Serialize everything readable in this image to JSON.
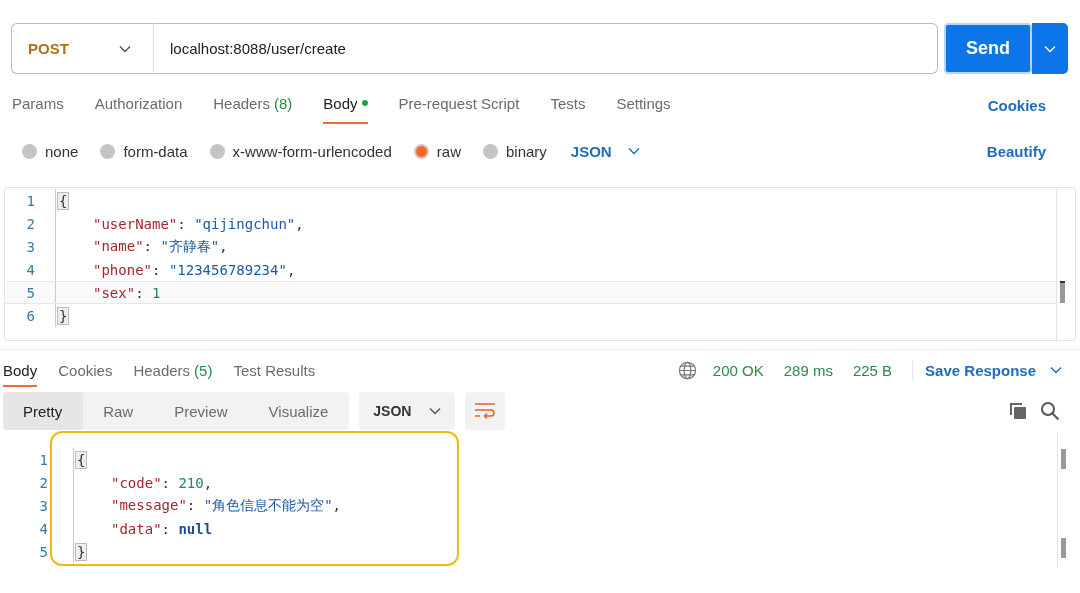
{
  "request": {
    "method": "POST",
    "url": "localhost:8088/user/create",
    "send_label": "Send"
  },
  "request_tabs": [
    {
      "label": "Params",
      "selected": false
    },
    {
      "label": "Authorization",
      "selected": false
    },
    {
      "label": "Headers",
      "count": "(8)",
      "selected": false
    },
    {
      "label": "Body",
      "selected": true,
      "dot": true
    },
    {
      "label": "Pre-request Script",
      "selected": false
    },
    {
      "label": "Tests",
      "selected": false
    },
    {
      "label": "Settings",
      "selected": false
    }
  ],
  "cookies_link": "Cookies",
  "body_types": [
    {
      "label": "none",
      "selected": false
    },
    {
      "label": "form-data",
      "selected": false
    },
    {
      "label": "x-www-form-urlencoded",
      "selected": false
    },
    {
      "label": "raw",
      "selected": true
    },
    {
      "label": "binary",
      "selected": false
    }
  ],
  "raw_format": "JSON",
  "beautify_link": "Beautify",
  "request_body": [
    {
      "number": "1",
      "kind": "brace",
      "active": false,
      "tokens": [
        {
          "kind": "punct",
          "text": "{"
        }
      ]
    },
    {
      "number": "2",
      "kind": "entry",
      "active": false,
      "tokens": [
        {
          "kind": "key",
          "text": "\"userName\""
        },
        {
          "kind": "punct",
          "text": ": "
        },
        {
          "kind": "string",
          "text": "\"qijingchun\""
        },
        {
          "kind": "punct",
          "text": ","
        }
      ]
    },
    {
      "number": "3",
      "kind": "entry",
      "active": false,
      "tokens": [
        {
          "kind": "key",
          "text": "\"name\""
        },
        {
          "kind": "punct",
          "text": ": "
        },
        {
          "kind": "string",
          "text": "\"齐静春\""
        },
        {
          "kind": "punct",
          "text": ","
        }
      ]
    },
    {
      "number": "4",
      "kind": "entry",
      "active": false,
      "tokens": [
        {
          "kind": "key",
          "text": "\"phone\""
        },
        {
          "kind": "punct",
          "text": ": "
        },
        {
          "kind": "string",
          "text": "\"123456789234\""
        },
        {
          "kind": "punct",
          "text": ","
        }
      ]
    },
    {
      "number": "5",
      "kind": "entry",
      "active": true,
      "tokens": [
        {
          "kind": "key",
          "text": "\"sex\""
        },
        {
          "kind": "punct",
          "text": ": "
        },
        {
          "kind": "number",
          "text": "1"
        }
      ]
    },
    {
      "number": "6",
      "kind": "brace",
      "active": false,
      "tokens": [
        {
          "kind": "punct",
          "text": "}"
        }
      ]
    }
  ],
  "response_tabs": [
    {
      "label": "Body",
      "selected": true
    },
    {
      "label": "Cookies",
      "selected": false
    },
    {
      "label": "Headers",
      "count": "(5)",
      "selected": false
    },
    {
      "label": "Test Results",
      "selected": false
    }
  ],
  "response_status": {
    "status": "200 OK",
    "time": "289 ms",
    "size": "225 B",
    "save_label": "Save Response"
  },
  "view_modes": [
    {
      "label": "Pretty",
      "selected": true
    },
    {
      "label": "Raw",
      "selected": false
    },
    {
      "label": "Preview",
      "selected": false
    },
    {
      "label": "Visualize",
      "selected": false
    }
  ],
  "response_format": "JSON",
  "response_body": [
    {
      "number": "1",
      "kind": "brace",
      "tokens": [
        {
          "kind": "punct",
          "text": "{"
        }
      ]
    },
    {
      "number": "2",
      "kind": "entry",
      "tokens": [
        {
          "kind": "key",
          "text": "\"code\""
        },
        {
          "kind": "punct",
          "text": ": "
        },
        {
          "kind": "number",
          "text": "210"
        },
        {
          "kind": "punct",
          "text": ","
        }
      ]
    },
    {
      "number": "3",
      "kind": "entry",
      "tokens": [
        {
          "kind": "key",
          "text": "\"message\""
        },
        {
          "kind": "punct",
          "text": ": "
        },
        {
          "kind": "string",
          "text": "\"角色信息不能为空\""
        },
        {
          "kind": "punct",
          "text": ","
        }
      ]
    },
    {
      "number": "4",
      "kind": "entry",
      "tokens": [
        {
          "kind": "key",
          "text": "\"data\""
        },
        {
          "kind": "punct",
          "text": ": "
        },
        {
          "kind": "null",
          "text": "null"
        }
      ]
    },
    {
      "number": "5",
      "kind": "brace",
      "tokens": [
        {
          "kind": "punct",
          "text": "}"
        }
      ]
    }
  ]
}
